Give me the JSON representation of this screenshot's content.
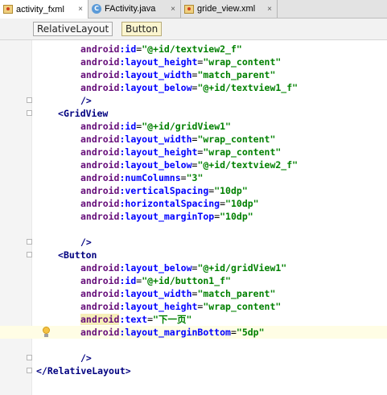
{
  "tabs": [
    {
      "label": "activity_fxml",
      "icon": "xml-file-icon",
      "active": true
    },
    {
      "label": "FActivity.java",
      "icon": "java-class-icon",
      "active": false
    },
    {
      "label": "gride_view.xml",
      "icon": "xml-file-icon",
      "active": false
    }
  ],
  "close_glyph": "×",
  "breadcrumb": [
    "RelativeLayout",
    "Button"
  ],
  "code": {
    "ns": "android",
    "colon": ":",
    "eq": "=",
    "l1": {
      "attr": "id",
      "value": "\"@+id/textview2_f\""
    },
    "l2": {
      "attr": "layout_height",
      "value": "\"wrap_content\""
    },
    "l3": {
      "attr": "layout_width",
      "value": "\"match_parent\""
    },
    "l4": {
      "attr": "layout_below",
      "value": "\"@+id/textview1_f\""
    },
    "l5": {
      "text": "/>"
    },
    "l6": {
      "open": "<",
      "tag": "GridView"
    },
    "l7": {
      "attr": "id",
      "value": "\"@+id/gridView1\""
    },
    "l8": {
      "attr": "layout_width",
      "value": "\"wrap_content\""
    },
    "l9": {
      "attr": "layout_height",
      "value": "\"wrap_content\""
    },
    "l10": {
      "attr": "layout_below",
      "value": "\"@+id/textview2_f\""
    },
    "l11": {
      "attr": "numColumns",
      "value": "\"3\""
    },
    "l12": {
      "attr": "verticalSpacing",
      "value": "\"10dp\""
    },
    "l13": {
      "attr": "horizontalSpacing",
      "value": "\"10dp\""
    },
    "l14": {
      "attr": "layout_marginTop",
      "value": "\"10dp\""
    },
    "l16": {
      "text": "/>"
    },
    "l17": {
      "open": "<",
      "tag": "Button"
    },
    "l18": {
      "attr": "layout_below",
      "value": "\"@+id/gridView1\""
    },
    "l19": {
      "attr": "id",
      "value": "\"@+id/button1_f\""
    },
    "l20": {
      "attr": "layout_width",
      "value": "\"match_parent\""
    },
    "l21": {
      "attr": "layout_height",
      "value": "\"wrap_content\""
    },
    "l22": {
      "attr": "text",
      "value": "\"下一页\""
    },
    "l23": {
      "attr": "layout_marginBottom",
      "value": "\"5dp\""
    },
    "l25": {
      "text": "/>"
    },
    "l26": {
      "open": "</",
      "tag": "RelativeLayout",
      "close": ">"
    }
  },
  "colors": {
    "namespace": "#660e7a",
    "attribute": "#0000ff",
    "value": "#008000",
    "tag": "#000080",
    "current_line": "#fffde5"
  }
}
